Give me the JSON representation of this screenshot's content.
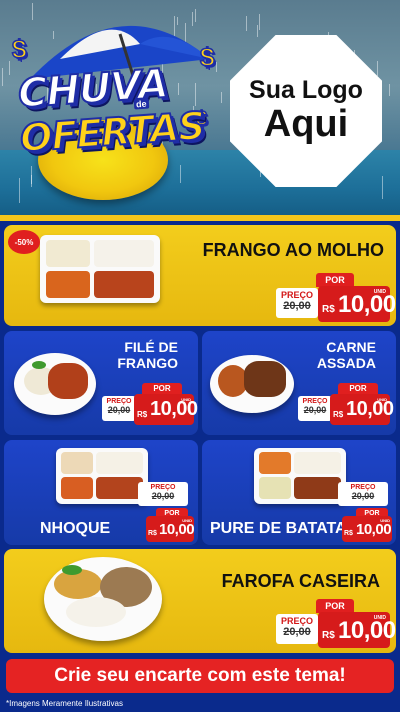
{
  "header": {
    "title_line1": "CHUVA",
    "title_de": "de",
    "title_line2": "OFERTAS",
    "logo_line1": "Sua Logo",
    "logo_line2": "Aqui"
  },
  "colors": {
    "yellow": "#f3cd1c",
    "blue": "#1e44c9",
    "red": "#e01f1f"
  },
  "discount_badge": "-50%",
  "price_labels": {
    "por": "POR",
    "preco": "PREÇO",
    "currency": "R$",
    "unit": "UNID"
  },
  "products": [
    {
      "name": "FRANGO AO MOLHO",
      "old_price": "20,00",
      "price": "10,00"
    },
    {
      "name_line1": "FILÉ DE",
      "name_line2": "FRANGO",
      "old_price": "20,00",
      "price": "10,00"
    },
    {
      "name_line1": "CARNE",
      "name_line2": "ASSADA",
      "old_price": "20,00",
      "price": "10,00"
    },
    {
      "name": "NHOQUE",
      "old_price": "20,00",
      "price": "10,00"
    },
    {
      "name": "PURE DE BATATA",
      "old_price": "20,00",
      "price": "10,00"
    },
    {
      "name": "FAROFA CASEIRA",
      "old_price": "20,00",
      "price": "10,00"
    }
  ],
  "cta": "Crie seu encarte com este tema!",
  "footnote": "*Imagens Meramente Ilustrativas"
}
